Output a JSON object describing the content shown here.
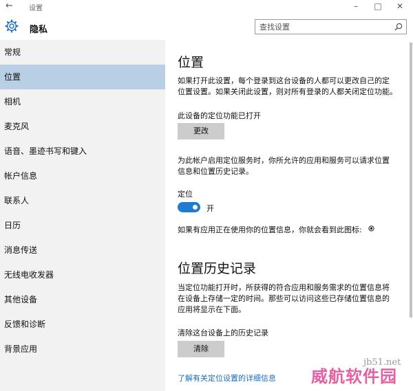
{
  "titlebar": {
    "back_icon": "back-arrow-icon",
    "app_title": "设置",
    "minimize_icon": "minimize-icon",
    "maximize_icon": "maximize-icon",
    "close_icon": "close-icon"
  },
  "header": {
    "icon": "gear-icon",
    "title": "隐私",
    "search_placeholder": "查找设置",
    "search_icon": "search-icon"
  },
  "sidebar": {
    "items": [
      {
        "label": "常规"
      },
      {
        "label": "位置",
        "active": true
      },
      {
        "label": "相机"
      },
      {
        "label": "麦克风"
      },
      {
        "label": "语音、墨迹书写和键入"
      },
      {
        "label": "帐户信息"
      },
      {
        "label": "联系人"
      },
      {
        "label": "日历"
      },
      {
        "label": "消息传送"
      },
      {
        "label": "无线电收发器"
      },
      {
        "label": "其他设备"
      },
      {
        "label": "反馈和诊断"
      },
      {
        "label": "背景应用"
      }
    ]
  },
  "main": {
    "section1_title": "位置",
    "section1_desc_line1": "如果打开此设置，每个登录到这台设备的人都可以更改自己的定",
    "section1_desc_line2": "位置设置。如果关闭此设置，则对所有登录的人都关闭定位功能。",
    "device_status": "此设备的定位功能已打开",
    "change_button": "更改",
    "service_desc_line1": "为此帐户启用定位服务时，你所允许的应用和服务可以请求位置",
    "service_desc_line2": "信息和位置历史记录。",
    "location_label": "定位",
    "location_toggle": {
      "state": "on",
      "label": "开"
    },
    "usage_note": "如果有应用正在使用你的位置信息，你就会看到此图标:",
    "usage_icon": "location-in-use-icon",
    "section2_title": "位置历史记录",
    "history_desc_line1": "当定位功能打开时，所获得的符合应用和服务需求的位置信息将",
    "history_desc_line2": "在设备上存储一定的时间。那些可以访问这些已存储位置信息的",
    "history_desc_line3": "应用将显示在下面。",
    "clear_history_label": "清除这台设备上的历史记录",
    "clear_button": "清除",
    "details_link": "了解有关定位设置的详细信息"
  },
  "watermark": {
    "site": "jb51.net",
    "text": "威航软件园"
  },
  "colors": {
    "accent": "#1f7cd1",
    "sidebar_bg": "#f2f2f2",
    "active_item_bg": "#b8cfe6",
    "button_bg": "#cccccc",
    "link": "#1a6fbf"
  }
}
